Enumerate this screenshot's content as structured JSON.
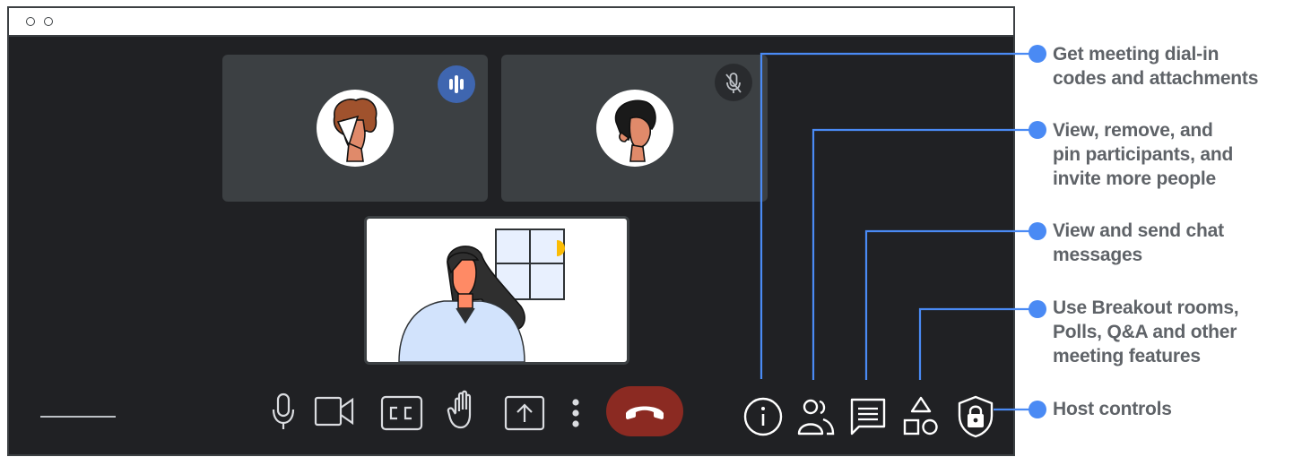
{
  "window": {
    "titlebar_dots": 2
  },
  "participants": [
    {
      "name_icon": "participant-avatar-curly-hair",
      "status": "speaking",
      "status_icon": "audio-level-icon"
    },
    {
      "name_icon": "participant-avatar-dark-hair",
      "status": "muted",
      "status_icon": "mic-off-icon"
    }
  ],
  "self_view": {
    "icon": "self-view-illustration"
  },
  "toolbar": {
    "controls": [
      {
        "id": "microphone",
        "icon": "microphone-icon"
      },
      {
        "id": "camera",
        "icon": "camera-icon"
      },
      {
        "id": "captions",
        "icon": "closed-captions-icon"
      },
      {
        "id": "raise-hand",
        "icon": "raise-hand-icon"
      },
      {
        "id": "present",
        "icon": "present-screen-icon"
      },
      {
        "id": "more-options",
        "icon": "more-vert-icon"
      },
      {
        "id": "leave-call",
        "icon": "hang-up-icon"
      }
    ],
    "side_controls": [
      {
        "id": "meeting-details",
        "icon": "info-icon"
      },
      {
        "id": "people",
        "icon": "people-icon"
      },
      {
        "id": "chat",
        "icon": "chat-icon"
      },
      {
        "id": "activities",
        "icon": "activities-icon"
      },
      {
        "id": "host-controls",
        "icon": "host-controls-shield-icon"
      }
    ]
  },
  "callouts": [
    {
      "text": "Get meeting dial-in\ncodes and attachments"
    },
    {
      "text": "View, remove, and\npin participants, and\ninvite more people"
    },
    {
      "text": "View and send chat\nmessages"
    },
    {
      "text": "Use Breakout rooms,\nPolls, Q&A and other\nmeeting features"
    },
    {
      "text": "Host controls"
    }
  ],
  "colors": {
    "callout_line": "#4a8af4",
    "callout_text": "#5f6368",
    "meeting_bg": "#202124",
    "tile_bg": "#3c4043",
    "speaking_badge": "#3f66b0",
    "hangup": "#8b2a22"
  }
}
